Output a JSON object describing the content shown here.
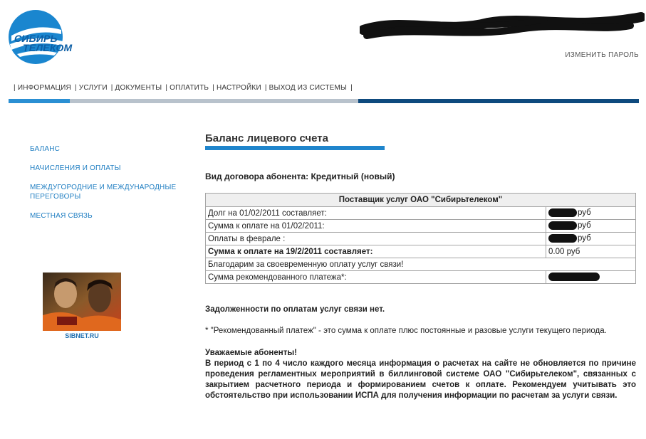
{
  "logo": {
    "line1": "СИБИРЬ",
    "line2": "ТЕЛЕКОМ"
  },
  "header": {
    "change_password": "ИЗМЕНИТЬ ПАРОЛЬ"
  },
  "nav": {
    "items": [
      "ИНФОРМАЦИЯ",
      "УСЛУГИ",
      "ДОКУМЕНТЫ",
      "ОПЛАТИТЬ",
      "НАСТРОЙКИ",
      "ВЫХОД ИЗ СИСТЕМЫ"
    ],
    "bar_colors": [
      "#2a8fd3",
      "#b8c2cc",
      "#0e4a7e"
    ]
  },
  "sidebar": {
    "items": [
      {
        "label": "БАЛАНС"
      },
      {
        "label": "НАЧИСЛЕНИЯ И ОПЛАТЫ"
      },
      {
        "label": "МЕЖДУГОРОДНИЕ И МЕЖДУНАРОДНЫЕ ПЕРЕГОВОРЫ"
      },
      {
        "label": "МЕСТНАЯ СВЯЗЬ"
      }
    ],
    "banner_caption": "SIBNET.RU"
  },
  "main": {
    "title": "Баланс лицевого счета",
    "contract_type": "Вид договора абонента: Кредитный (новый)",
    "table": {
      "header": "Поставщик услуг ОАО \"Сибирьтелеком\"",
      "rows": [
        {
          "label": "Долг на 01/02/2011 составляет:",
          "value": "руб"
        },
        {
          "label": "Сумма к оплате на 01/02/2011:",
          "value": "руб"
        },
        {
          "label": "Оплаты в феврале :",
          "value": "руб"
        },
        {
          "label": "Сумма к оплате на 19/2/2011 составляет:",
          "value": "0.00 руб"
        },
        {
          "label": "Благодарим за своевременную оплату услуг связи!"
        },
        {
          "label": "Сумма рекомендованного платежа*:",
          "value": ""
        }
      ]
    },
    "no_debt": "Задолженности по оплатам услуг связи нет.",
    "footnote": "* \"Рекомендованный платеж\" - это сумма к оплате плюс постоянные и разовые услуги текущего периода.",
    "notice_title": "Уважаемые абоненты!",
    "notice_before": "В период с ",
    "notice_from": "1",
    "notice_mid": " по ",
    "notice_to": "4",
    "notice_body": " число каждого месяца информация о расчетах на сайте не обновляется по причине проведения регламентных мероприятий в биллинговой системе ОАО \"Сибирьтелеком\", связанных с закрытием расчетного периода и формированием счетов к оплате. Рекомендуем учитывать это обстоятельство при использовании ИСПА для получения информации по расчетам за услуги связи."
  }
}
